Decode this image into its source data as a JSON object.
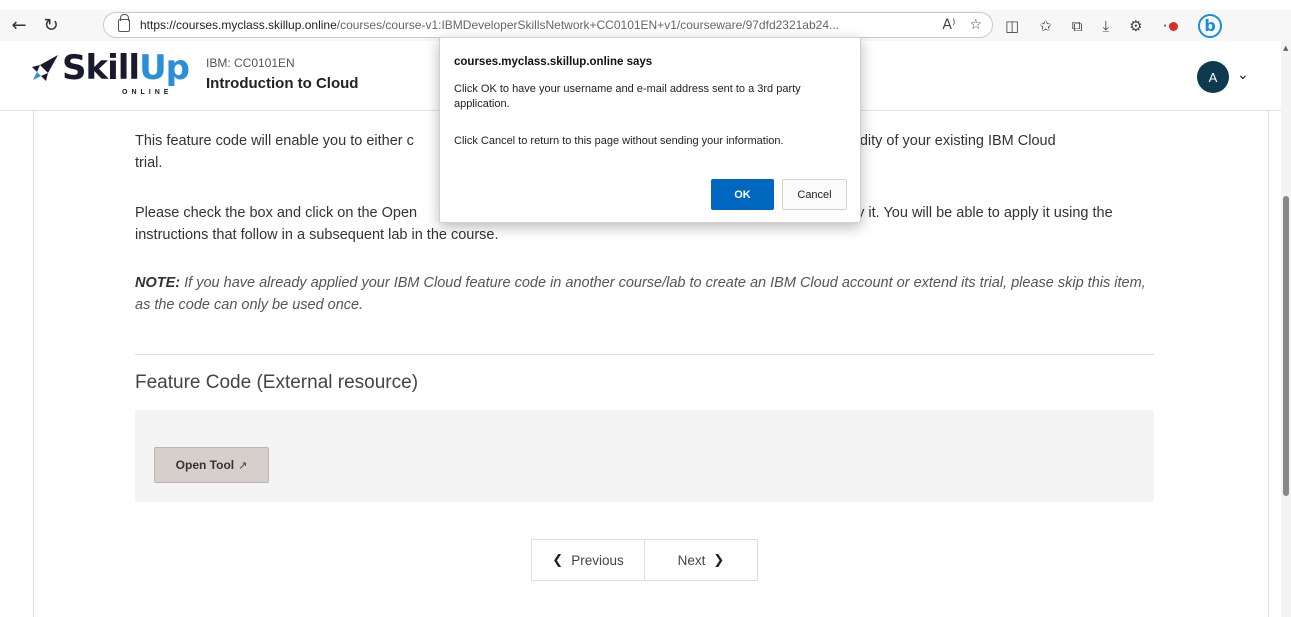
{
  "browser": {
    "url_host": "https://courses.myclass.skillup.online",
    "url_path": "/courses/course-v1:IBMDeveloperSkillsNetwork+CC0101EN+v1/courseware/97dfd2321ab24...",
    "icons": [
      "back-icon",
      "refresh-icon",
      "lock-icon",
      "read-aloud-icon",
      "favorite-star-icon",
      "split-screen-icon",
      "favorites-icon",
      "collections-icon",
      "downloads-icon",
      "extensions-icon",
      "more-icon",
      "bing-icon"
    ]
  },
  "header": {
    "logo_skill": "Skill",
    "logo_up": "Up",
    "logo_online": "ONLINE",
    "course_code": "IBM: CC0101EN",
    "course_title": "Introduction to Cloud",
    "avatar_initial": "A"
  },
  "content": {
    "para1_start": "This feature code will enable you to either c",
    "para1_end": "the validity of your existing IBM Cloud",
    "para1_line2": "trial.",
    "para2_start": "Please check the box and click on the Open",
    "para2_end": "y it. You will be able to apply it using the",
    "para2_line2": "instructions that follow in a subsequent lab in the course.",
    "note_label": "NOTE:",
    "note_text": " If you have already applied your IBM Cloud feature code in another course/lab to create an IBM Cloud account or extend its trial, please skip this item, as the code can only be used once.",
    "section_heading": "Feature Code (External resource)",
    "open_tool_label": "Open Tool",
    "prev_label": "Previous",
    "next_label": "Next"
  },
  "dialog": {
    "title": "courses.myclass.skillup.online says",
    "message1": "Click OK to have your username and e-mail address sent to a 3rd party application.",
    "message2": "Click Cancel to return to this page without sending your information.",
    "ok_label": "OK",
    "cancel_label": "Cancel"
  },
  "colors": {
    "ok_button": "#0067c0",
    "avatar": "#0e3a4f",
    "logo_accent": "#2a8fd6",
    "open_tool_button": "#d7cfcc"
  }
}
